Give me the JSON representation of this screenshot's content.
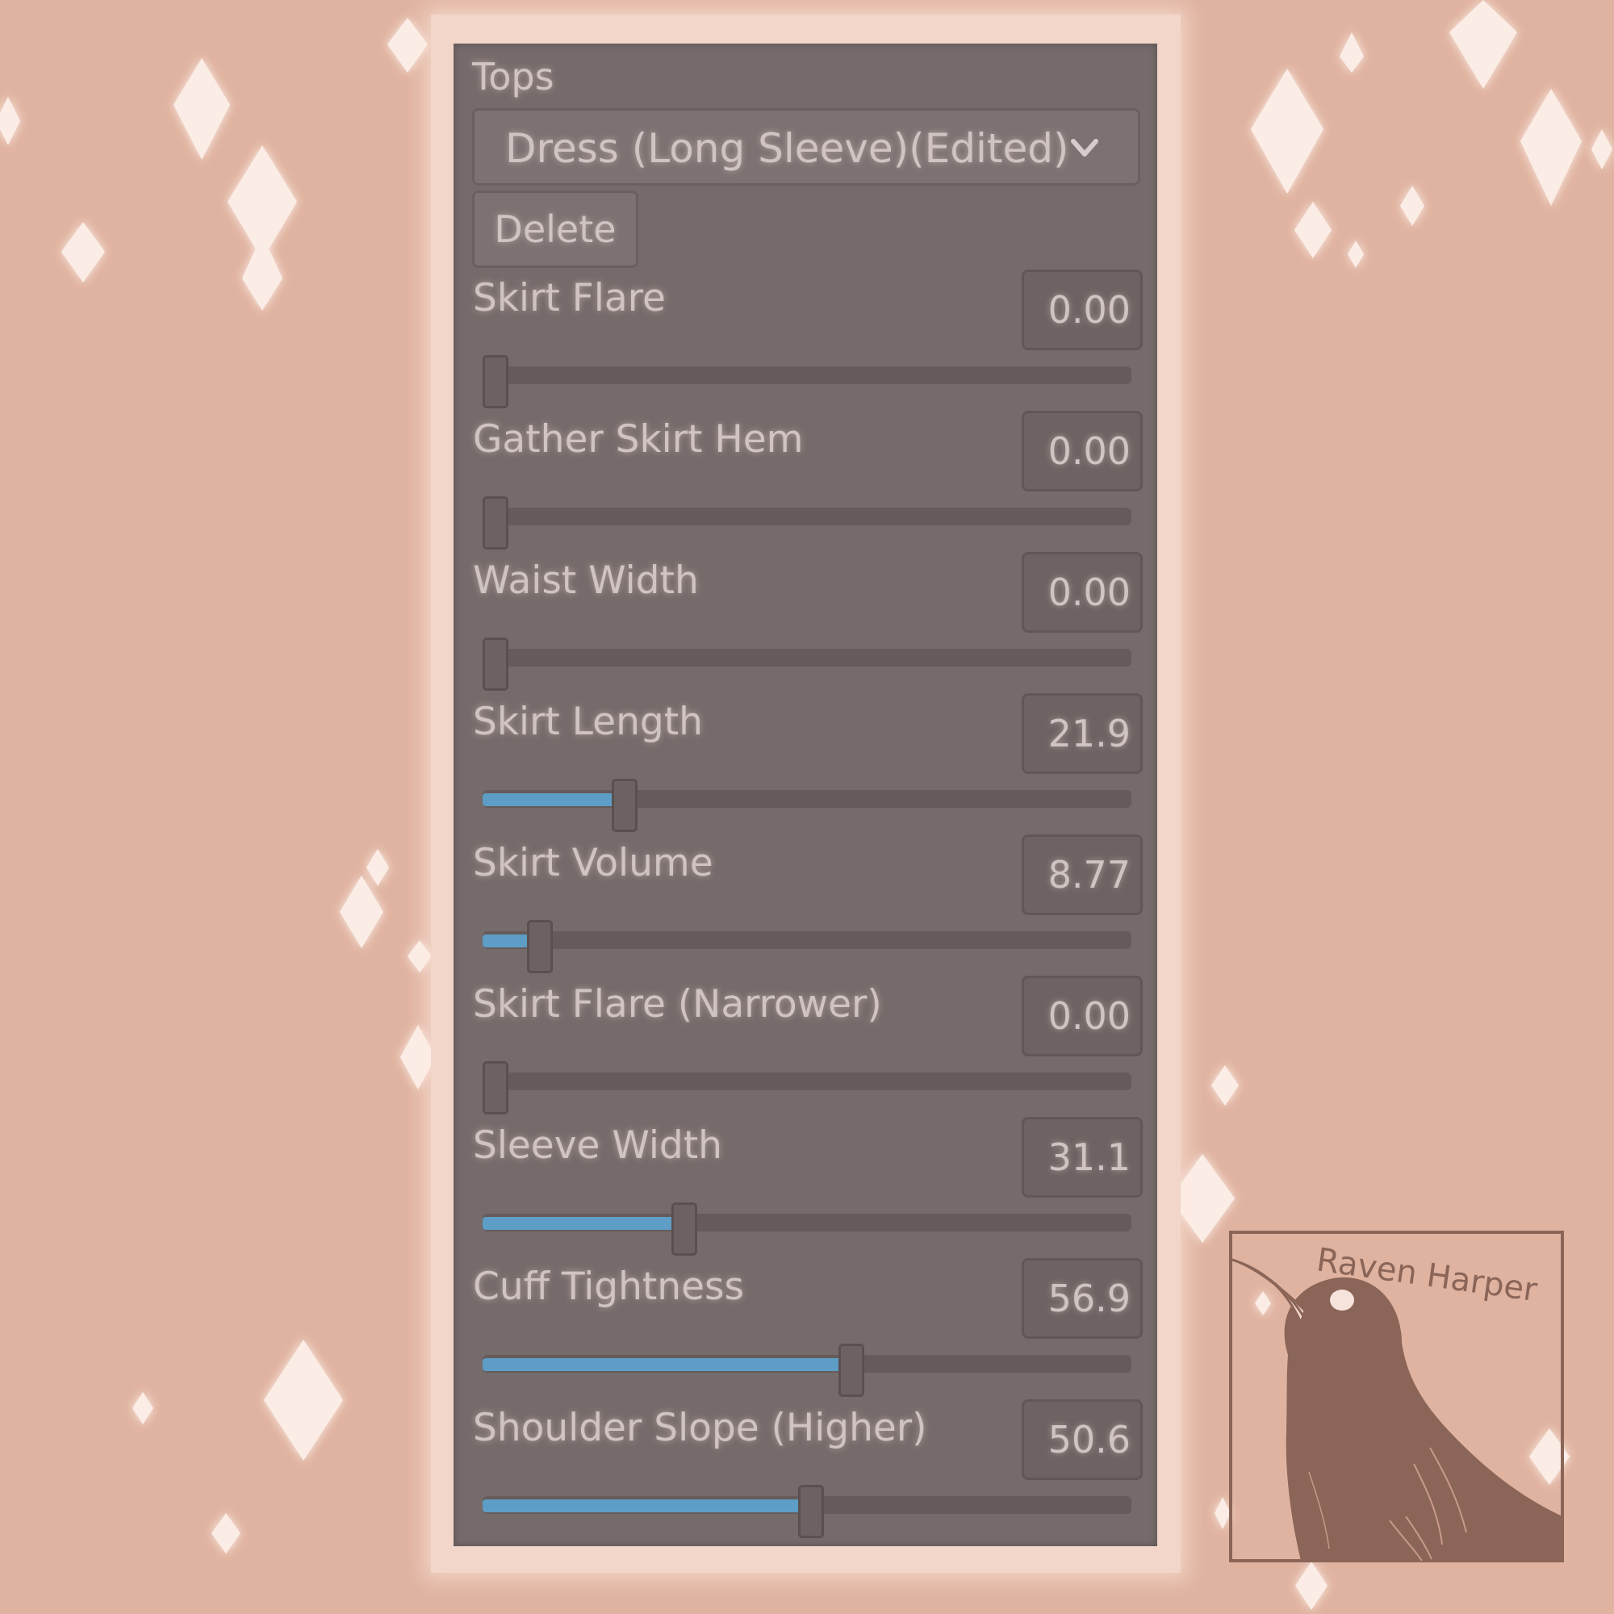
{
  "colors": {
    "background": "#e0b3a0",
    "panel": "#766b6b",
    "text": "#cfc3c3",
    "slider_fill": "#5d9dc6",
    "logo_brown": "#8a6558"
  },
  "panel": {
    "title": "Tops",
    "dropdown": {
      "value": "Dress (Long Sleeve)(Edited)",
      "icon": "chevron-down-icon"
    },
    "delete_label": "Delete",
    "sliders": [
      {
        "label": "Skirt Flare",
        "value": "0.00",
        "fraction": 0.0
      },
      {
        "label": "Gather Skirt Hem",
        "value": "0.00",
        "fraction": 0.0
      },
      {
        "label": "Waist Width",
        "value": "0.00",
        "fraction": 0.0
      },
      {
        "label": "Skirt Length",
        "value": "21.9",
        "fraction": 0.219
      },
      {
        "label": "Skirt Volume",
        "value": "8.77",
        "fraction": 0.0877
      },
      {
        "label": "Skirt Flare (Narrower)",
        "value": "0.00",
        "fraction": 0.0
      },
      {
        "label": "Sleeve Width",
        "value": "31.1",
        "fraction": 0.311
      },
      {
        "label": "Cuff Tightness",
        "value": "56.9",
        "fraction": 0.569
      },
      {
        "label": "Shoulder Slope (Higher)",
        "value": "50.6",
        "fraction": 0.506
      }
    ]
  },
  "watermark": {
    "text": "Raven Harper",
    "icon": "crow-icon"
  }
}
